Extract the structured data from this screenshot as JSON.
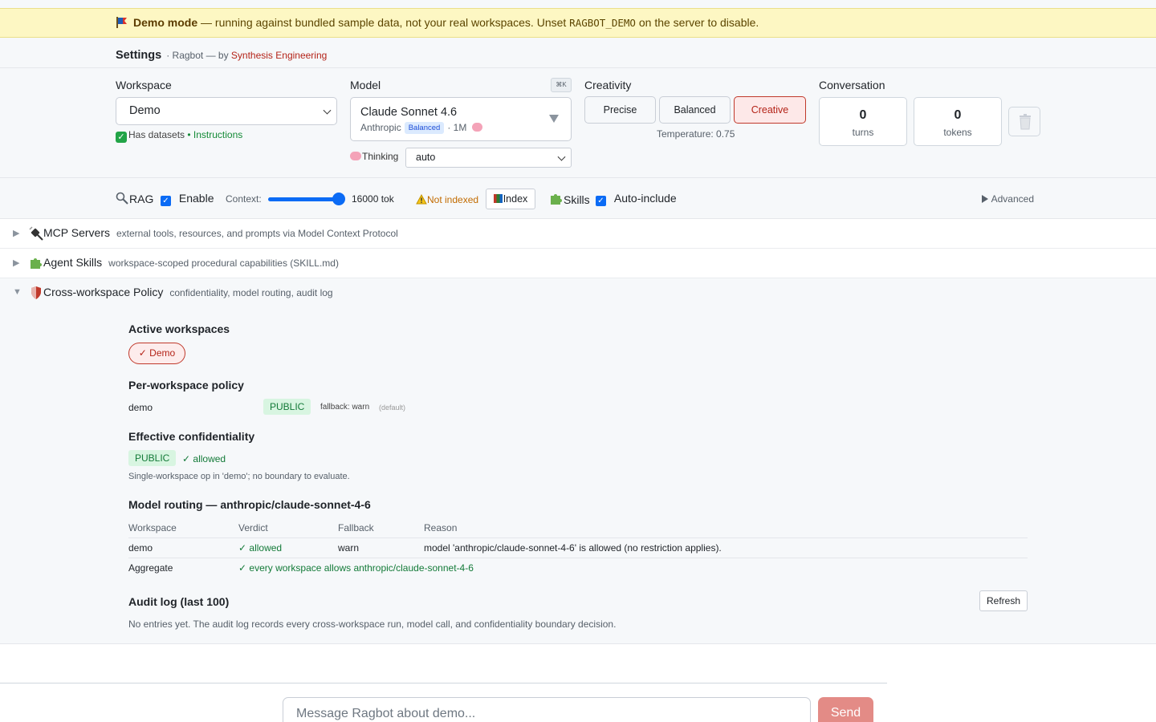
{
  "banner": {
    "title": "Demo mode",
    "text_before": " — running against bundled sample data, not your real workspaces. Unset ",
    "env_var": "RAGBOT_DEMO",
    "text_after": " on the server to disable."
  },
  "header": {
    "title": "Settings",
    "subtitle_prefix": "· Ragbot — by ",
    "brand": "Synthesis Engineering"
  },
  "workspace": {
    "label": "Workspace",
    "selected": "Demo",
    "has_datasets": "Has datasets",
    "separator": " • ",
    "instructions": "Instructions"
  },
  "model": {
    "label": "Model",
    "shortcut": "⌘K",
    "name": "Claude Sonnet 4.6",
    "provider": "Anthropic",
    "badge": "Balanced",
    "context": "· 1M",
    "thinking_label": "Thinking",
    "thinking_value": "auto"
  },
  "creativity": {
    "label": "Creativity",
    "options": [
      "Precise",
      "Balanced",
      "Creative"
    ],
    "selected": "Creative",
    "temperature": "Temperature: 0.75"
  },
  "conversation": {
    "label": "Conversation",
    "turns_value": "0",
    "turns_label": "turns",
    "tokens_value": "0",
    "tokens_label": "tokens"
  },
  "rag": {
    "label": "RAG",
    "enable_label": "Enable",
    "enabled": true,
    "context_label": "Context:",
    "context_value": "16000 tok",
    "context_fraction": 0.9,
    "status": "Not indexed",
    "index_button": "Index",
    "skills_label": "Skills",
    "auto_include_label": "Auto-include",
    "advanced": "Advanced"
  },
  "sections": [
    {
      "title": "MCP Servers",
      "desc": "external tools, resources, and prompts via Model Context Protocol",
      "open": false
    },
    {
      "title": "Agent Skills",
      "desc": "workspace-scoped procedural capabilities (SKILL.md)",
      "open": false
    },
    {
      "title": "Cross-workspace Policy",
      "desc": "confidentiality, model routing, audit log",
      "open": true
    }
  ],
  "policy": {
    "active_heading": "Active workspaces",
    "active_pill": "✓ Demo",
    "per_ws_heading": "Per-workspace policy",
    "ws_name": "demo",
    "ws_level": "PUBLIC",
    "ws_fallback": "fallback: warn",
    "ws_default": "(default)",
    "eff_heading": "Effective confidentiality",
    "eff_level": "PUBLIC",
    "eff_allowed": "✓ allowed",
    "eff_note": "Single-workspace op in 'demo'; no boundary to evaluate.",
    "routing_heading": "Model routing — anthropic/claude-sonnet-4-6",
    "routing_cols": [
      "Workspace",
      "Verdict",
      "Fallback",
      "Reason"
    ],
    "routing_rows": [
      [
        "demo",
        "✓ allowed",
        "warn",
        "model 'anthropic/claude-sonnet-4-6' is allowed (no restriction applies)."
      ]
    ],
    "aggregate_label": "Aggregate",
    "aggregate_value": "✓ every workspace allows anthropic/claude-sonnet-4-6",
    "audit_heading": "Audit log (last 100)",
    "refresh_button": "Refresh",
    "audit_empty": "No entries yet. The audit log records every cross-workspace run, model call, and confidentiality boundary decision."
  },
  "composer": {
    "placeholder": "Message Ragbot about demo...",
    "send": "Send"
  },
  "colors": {
    "accent_red": "#b42318",
    "accent_blue": "#0b6bf5",
    "public_green": "#137a38",
    "banner_yellow": "#fdf7c3"
  },
  "icons": {
    "banner": "flag-icon",
    "thinking": "brain-icon",
    "rag": "magnifier-icon",
    "index": "books-icon",
    "skills": "puzzle-icon",
    "mcp": "plug-icon",
    "policy": "shield-icon",
    "trash": "trash-icon",
    "warning": "warning-icon"
  }
}
